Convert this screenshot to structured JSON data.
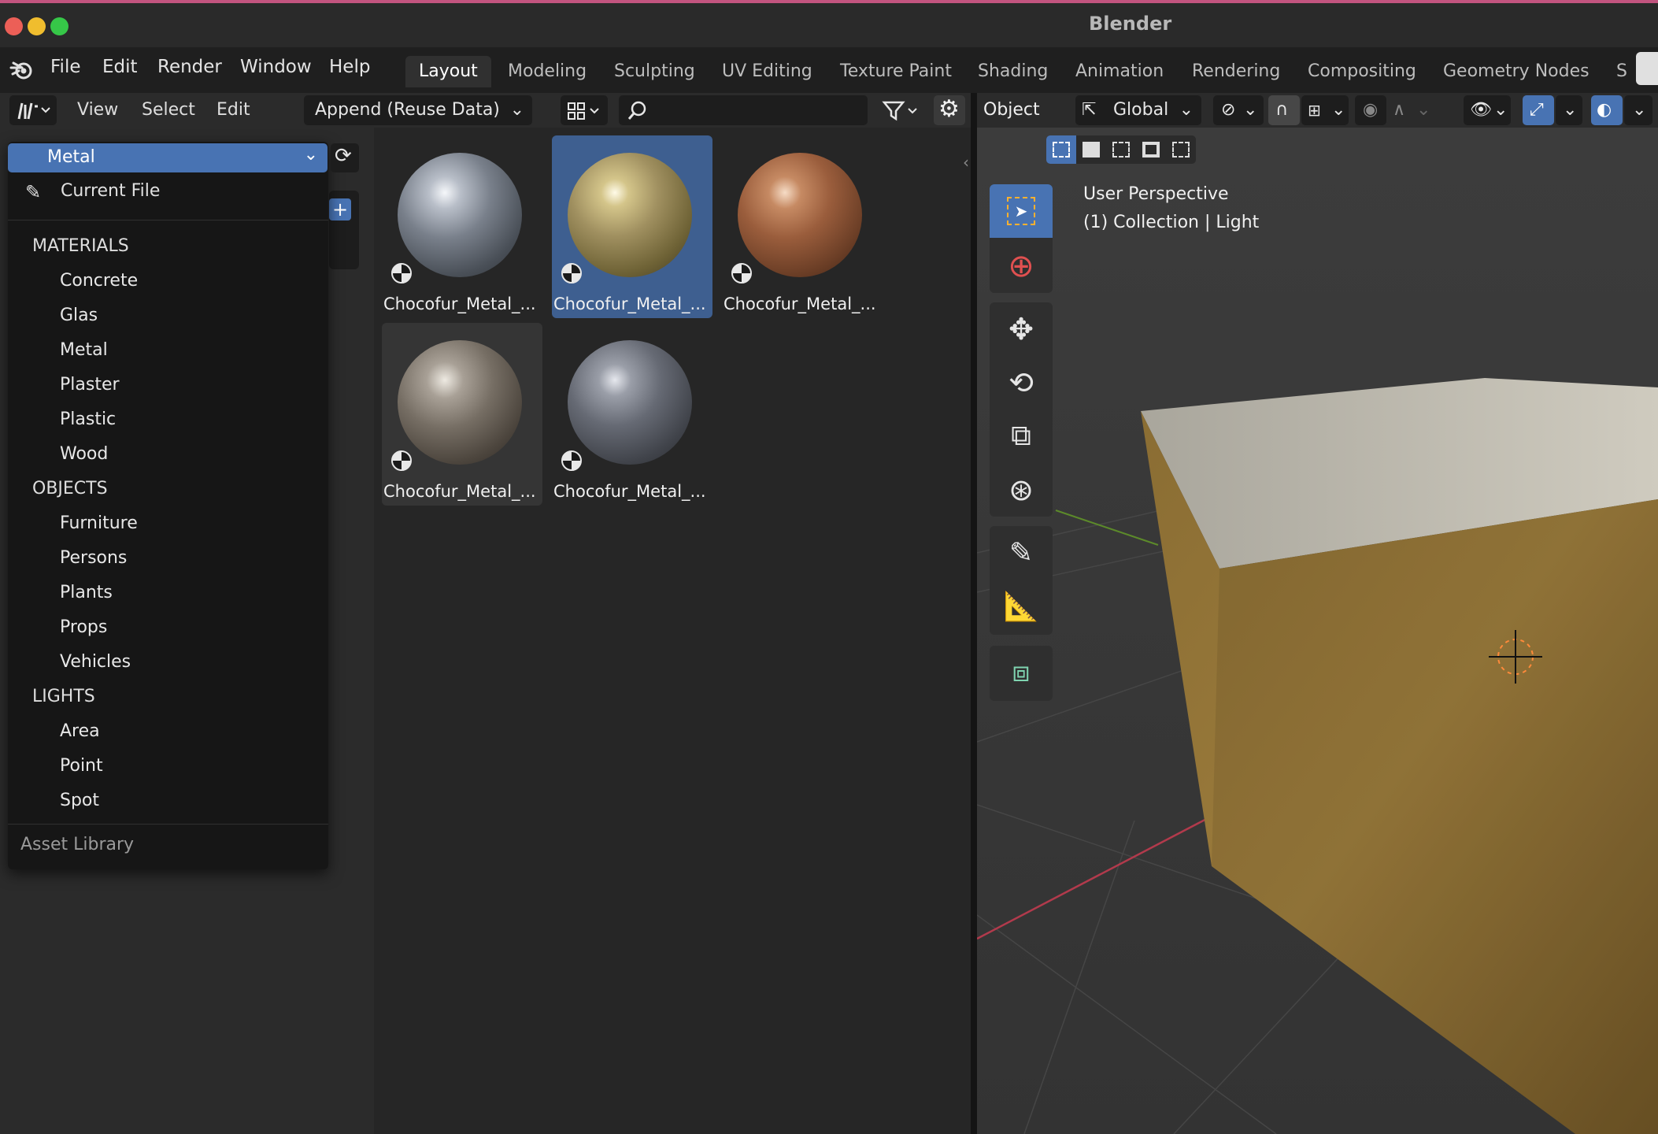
{
  "window": {
    "title": "Blender"
  },
  "menu": [
    "File",
    "Edit",
    "Render",
    "Window",
    "Help"
  ],
  "workspaces": [
    "Layout",
    "Modeling",
    "Sculpting",
    "UV Editing",
    "Texture Paint",
    "Shading",
    "Animation",
    "Rendering",
    "Compositing",
    "Geometry Nodes",
    "S"
  ],
  "active_workspace": "Layout",
  "asset_browser": {
    "header": {
      "view": "View",
      "select": "Select",
      "edit": "Edit",
      "import_mode": "Append (Reuse Data)",
      "search_placeholder": ""
    },
    "library": {
      "selected": "Metal",
      "current_file": "Current File"
    },
    "catalogs": {
      "materials_label": "MATERIALS",
      "materials": [
        "Concrete",
        "Glas",
        "Metal",
        "Plaster",
        "Plastic",
        "Wood"
      ],
      "objects_label": "OBJECTS",
      "objects": [
        "Furniture",
        "Persons",
        "Plants",
        "Props",
        "Vehicles"
      ],
      "lights_label": "LIGHTS",
      "lights": [
        "Area",
        "Point",
        "Spot"
      ]
    },
    "footer": "Asset Library",
    "assets": [
      {
        "name": "Chocofur_Metal_...",
        "color": "#8b9099"
      },
      {
        "name": "Chocofur_Metal_...",
        "color": "#a89a6a"
      },
      {
        "name": "Chocofur_Metal_...",
        "color": "#a06a4a"
      },
      {
        "name": "Chocofur_Metal_...",
        "color": "#7a736a"
      },
      {
        "name": "Chocofur_Metal_...",
        "color": "#6f737c"
      }
    ]
  },
  "viewport": {
    "mode": "Object",
    "orientation": "Global",
    "overlay_text": [
      "User Perspective",
      "(1) Collection | Light"
    ]
  },
  "colors": {
    "accent": "#4873b3",
    "selected_tile": "#3e5f90"
  }
}
